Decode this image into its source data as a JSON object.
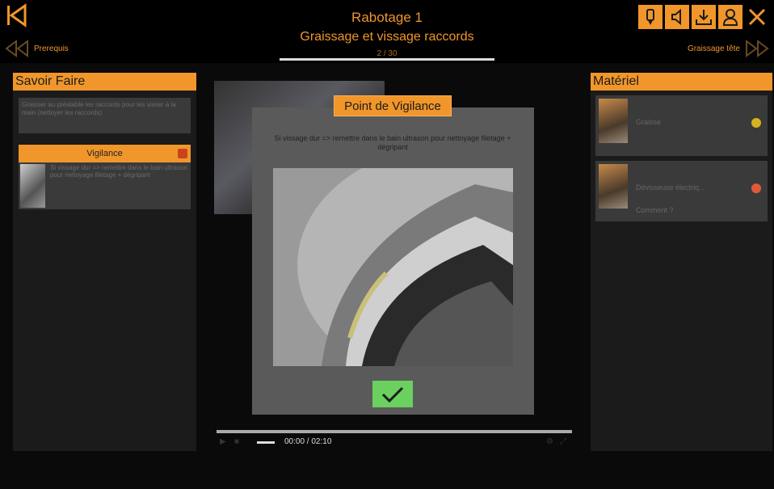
{
  "header": {
    "title": "Rabotage 1",
    "subtitle": "Graissage et vissage raccords",
    "progress": "2 / 30",
    "prev_label": "Prerequis",
    "next_label": "Graissage tête"
  },
  "left_panel": {
    "title": "Savoir Faire",
    "description": "Graisser au préalable les raccords pour les visser à la main (nettoyer les raccords)",
    "vigilance_label": "Vigilance",
    "vigilance_text": "Si vissage dur => remettre dans le bain ultrason pour nettoyage filetage + dégripant"
  },
  "right_panel": {
    "title": "Matériel",
    "items": [
      {
        "name": "Graisse",
        "status_color": "#d6b21e"
      },
      {
        "name": "Dévisseuse électriq...",
        "sub": "Comment ?",
        "status_color": "#e05a3a"
      }
    ]
  },
  "modal": {
    "title": "Point de Vigilance",
    "text": "Si vissage dur => remettre dans le bain ultrason pour nettoyage filetage + dégripant"
  },
  "player": {
    "time": "00:00 / 02:10"
  },
  "colors": {
    "accent": "#f0962a",
    "ok": "#6ad05e"
  }
}
